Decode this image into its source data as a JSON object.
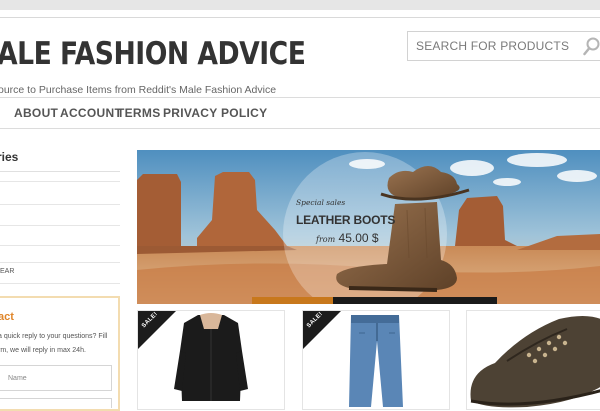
{
  "header": {
    "site_title": "ALE FASHION ADVICE",
    "tagline": "ource to Purchase Items from Reddit's Male Fashion Advice"
  },
  "search": {
    "placeholder": "SEARCH FOR PRODUCTS"
  },
  "nav": {
    "items": [
      {
        "label": "ABOUT"
      },
      {
        "label": "ACCOUNT"
      },
      {
        "label": "TERMS"
      },
      {
        "label": "PRIVACY POLICY"
      }
    ]
  },
  "sidebar": {
    "categories_title": "ries",
    "visible_category_fragment": "EAR",
    "contact": {
      "title": "act",
      "text": "a quick reply to your questions? Fill rm, we will reply in max 24h.",
      "name_placeholder": "Name"
    }
  },
  "banner": {
    "line1": "Special sales",
    "line2": "LEATHER BOOTS",
    "line3_prefix": "from",
    "line3_price": "45.00 $",
    "slider_segments": 3,
    "slider_active_index": 0,
    "slider_active_color": "#c8781c"
  },
  "products": [
    {
      "badge": "SALE!",
      "item": "coat"
    },
    {
      "badge": "SALE!",
      "item": "jeans"
    },
    {
      "badge": "",
      "item": "shoe"
    }
  ],
  "colors": {
    "accent": "#e0862a",
    "sale_badge": "#1c1c1c",
    "text_dark": "#333333"
  }
}
